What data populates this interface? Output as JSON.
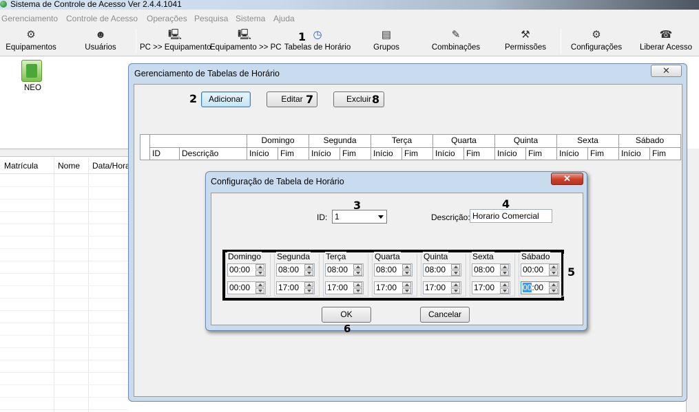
{
  "window": {
    "title": "Sistema de Controle de Acesso  Ver 2.4.4.1041"
  },
  "menu": [
    "Gerenciamento",
    "Controle de Acesso",
    "Operações",
    "Pesquisa",
    "Sistema",
    "Ajuda"
  ],
  "toolbar": [
    {
      "label": "Equipamentos",
      "icon": "devices-icon"
    },
    {
      "label": "Usuários",
      "icon": "users-icon"
    },
    {
      "label": "PC >> Equipamento",
      "icon": "upload-to-device-icon"
    },
    {
      "label": "Equipamento >> PC",
      "icon": "download-to-pc-icon"
    },
    {
      "label": "Tabelas de Horário",
      "icon": "clock-icon"
    },
    {
      "label": "Grupos",
      "icon": "groups-icon"
    },
    {
      "label": "Combinações",
      "icon": "combinations-icon"
    },
    {
      "label": "Permissões",
      "icon": "permissions-icon"
    },
    {
      "label": "Configurações",
      "icon": "settings-icon"
    },
    {
      "label": "Liberar Acesso",
      "icon": "release-access-icon"
    }
  ],
  "left_panel": {
    "device_label": "NEO"
  },
  "background_grid": {
    "columns": [
      "Matrícula",
      "Nome",
      "Data/Hora"
    ]
  },
  "manager": {
    "title": "Gerenciamento de Tabelas de Horário",
    "close_glyph": "✕",
    "buttons": {
      "add": "Adicionar",
      "edit": "Editar",
      "delete": "Excluir"
    },
    "grid": {
      "id_header": "ID",
      "desc_header": "Descrição",
      "days": [
        "Domingo",
        "Segunda",
        "Terça",
        "Quarta",
        "Quinta",
        "Sexta",
        "Sábado"
      ],
      "start_header": "Início",
      "end_header": "Fim"
    }
  },
  "config": {
    "title": "Configuração de Tabela de Horário",
    "close_glyph": "✕",
    "id_label": "ID:",
    "id_value": "1",
    "desc_label": "Descrição:",
    "desc_value": "Horario Comercial",
    "days": [
      {
        "name": "Domingo",
        "start": "00:00",
        "end": "00:00"
      },
      {
        "name": "Segunda",
        "start": "08:00",
        "end": "17:00"
      },
      {
        "name": "Terça",
        "start": "08:00",
        "end": "17:00"
      },
      {
        "name": "Quarta",
        "start": "08:00",
        "end": "17:00"
      },
      {
        "name": "Quinta",
        "start": "08:00",
        "end": "17:00"
      },
      {
        "name": "Sexta",
        "start": "08:00",
        "end": "17:00"
      },
      {
        "name": "Sábado",
        "start": "00:00",
        "end_hh": "00",
        "end_mm": ":00"
      }
    ],
    "ok": "OK",
    "cancel": "Cancelar"
  },
  "callouts": {
    "n1": "1",
    "n2": "2",
    "n3": "3",
    "n4": "4",
    "n5": "5",
    "n6": "6",
    "n7": "7",
    "n8": "8"
  }
}
